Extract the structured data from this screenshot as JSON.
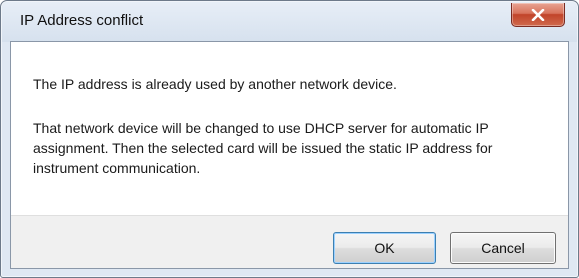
{
  "dialog": {
    "title": "IP Address conflict",
    "close_icon": "close-icon",
    "message_line1": "The IP address is already used by another network device.",
    "message_line2": "That network device will be changed to use DHCP server for automatic IP\nassignment. Then the selected card will be issued the static IP address for\ninstrument communication.",
    "ok_label": "OK",
    "cancel_label": "Cancel"
  },
  "colors": {
    "close_button": "#c8553d",
    "frame": "#dfe8f3",
    "footer": "#f0f0f0"
  }
}
